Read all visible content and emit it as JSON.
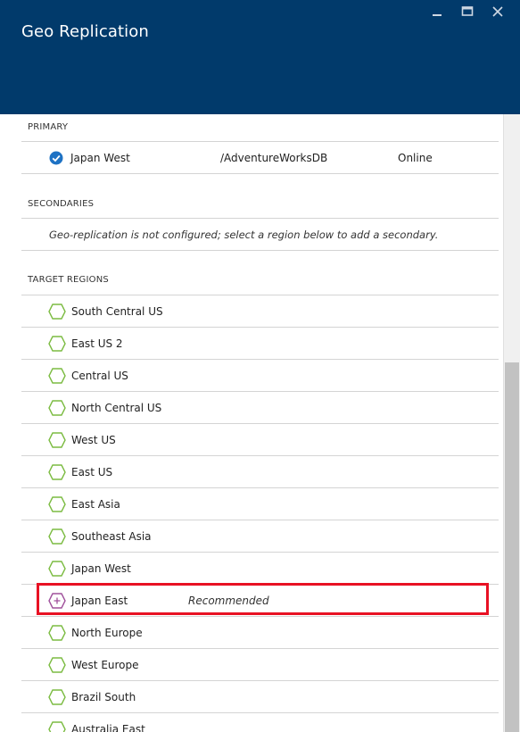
{
  "window": {
    "title": "Geo Replication",
    "controls": [
      "minimize",
      "maximize",
      "close"
    ]
  },
  "primary": {
    "label": "PRIMARY",
    "region": "Japan West",
    "database": "/AdventureWorksDB",
    "status": "Online"
  },
  "secondaries": {
    "label": "SECONDARIES",
    "message": "Geo-replication is not configured; select a region below to add a secondary."
  },
  "target_regions": {
    "label": "TARGET REGIONS",
    "items": [
      {
        "name": "South Central US",
        "note": ""
      },
      {
        "name": "East US 2",
        "note": ""
      },
      {
        "name": "Central US",
        "note": ""
      },
      {
        "name": "North Central US",
        "note": ""
      },
      {
        "name": "West US",
        "note": ""
      },
      {
        "name": "East US",
        "note": ""
      },
      {
        "name": "East Asia",
        "note": ""
      },
      {
        "name": "Southeast Asia",
        "note": ""
      },
      {
        "name": "Japan West",
        "note": ""
      },
      {
        "name": "Japan East",
        "note": "Recommended"
      },
      {
        "name": "North Europe",
        "note": ""
      },
      {
        "name": "West Europe",
        "note": ""
      },
      {
        "name": "Brazil South",
        "note": ""
      },
      {
        "name": "Australia East",
        "note": ""
      }
    ]
  },
  "colors": {
    "header_bg": "#013a6b",
    "hex_green": "#7cbc42",
    "hex_purple": "#a0519c",
    "check_blue": "#1e72c4",
    "highlight_red": "#e81123"
  },
  "icons": {
    "region": "hexagon-icon",
    "recommended": "hexagon-plus-icon",
    "primary": "checkmark-circle-icon"
  }
}
